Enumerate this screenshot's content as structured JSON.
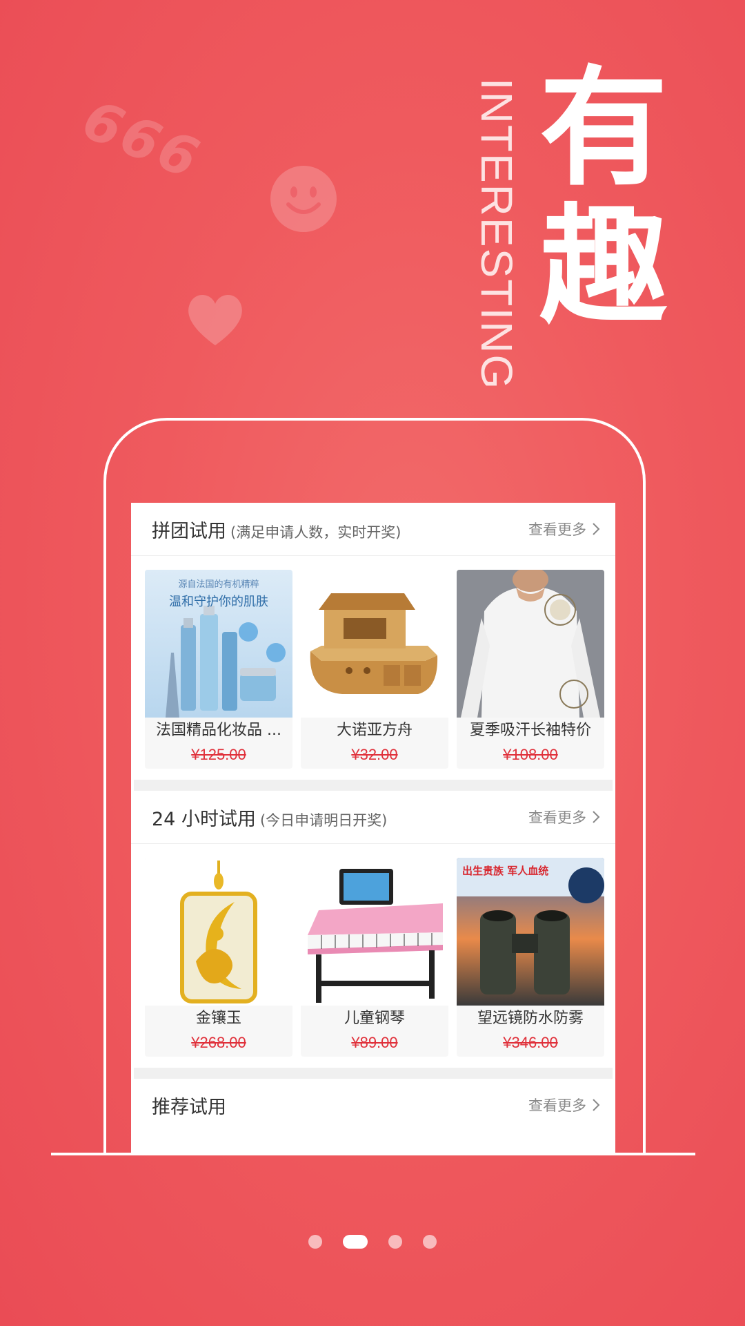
{
  "hero": {
    "title_line1": "有",
    "title_line2": "趣",
    "english": "INTERESTING",
    "decor_number": "666"
  },
  "sections": [
    {
      "title": "拼团试用",
      "subtitle": "(满足申请人数，实时开奖)",
      "more_label": "查看更多",
      "products": [
        {
          "name": "法国精品化妆品 ...",
          "price": "¥125.00",
          "image": "cosmetics-image",
          "banner_line1": "源自法国的有机精粹",
          "banner_line2": "温和守护你的肌肤"
        },
        {
          "name": "大诺亚方舟",
          "price": "¥32.00",
          "image": "wooden-ark-image"
        },
        {
          "name": "夏季吸汗长袖特价",
          "price": "¥108.00",
          "image": "white-shirt-image"
        }
      ]
    },
    {
      "title": "24 小时试用",
      "subtitle": "(今日申请明日开奖)",
      "more_label": "查看更多",
      "products": [
        {
          "name": "金镶玉",
          "price": "¥268.00",
          "image": "gold-jade-pendant-image"
        },
        {
          "name": "儿童钢琴",
          "price": "¥89.00",
          "image": "kids-piano-image"
        },
        {
          "name": "望远镜防水防雾",
          "price": "¥346.00",
          "image": "binoculars-image",
          "banner_line1": "出生贵族 军人血统"
        }
      ]
    },
    {
      "title": "推荐试用",
      "subtitle": "",
      "more_label": "查看更多",
      "products": []
    }
  ],
  "pagination": {
    "total": 4,
    "active_index": 1
  },
  "colors": {
    "background": "#ef5a5e",
    "accent_price": "#e0303a",
    "frame": "#ffffff"
  }
}
